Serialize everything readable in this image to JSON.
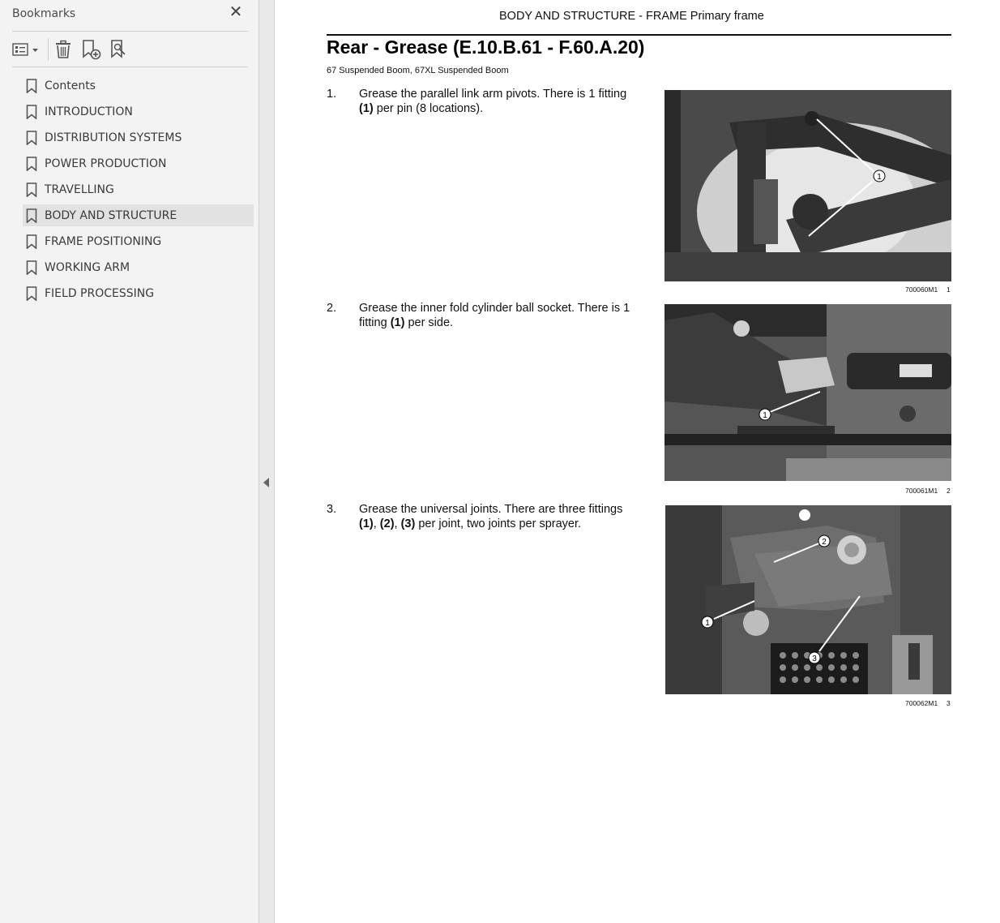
{
  "sidebar": {
    "title": "Bookmarks",
    "close_icon": "close-icon",
    "toolbar": {
      "options_icon": "bookmark-options-icon",
      "delete_icon": "trash-icon",
      "add_icon": "new-bookmark-icon",
      "find_icon": "find-current-bookmark-icon"
    },
    "items": [
      {
        "label": "Contents"
      },
      {
        "label": "INTRODUCTION"
      },
      {
        "label": "DISTRIBUTION SYSTEMS"
      },
      {
        "label": "POWER PRODUCTION"
      },
      {
        "label": "TRAVELLING"
      },
      {
        "label": "BODY AND STRUCTURE",
        "selected": true
      },
      {
        "label": "FRAME POSITIONING"
      },
      {
        "label": "WORKING ARM"
      },
      {
        "label": "FIELD PROCESSING"
      }
    ]
  },
  "document": {
    "header": "BODY AND STRUCTURE - FRAME Primary frame",
    "title": "Rear - Grease (E.10.B.61 - F.60.A.20)",
    "models": "67 Suspended Boom, 67XL Suspended Boom",
    "steps": [
      {
        "number": "1.",
        "text_a": "Grease the parallel link arm pivots. There is 1 fitting",
        "bold_1": "(1)",
        "text_b": " per pin (8 locations).",
        "figure_code": "700060M1",
        "figure_number": "1",
        "callouts": [
          "1"
        ]
      },
      {
        "number": "2.",
        "text_a": "Grease the inner fold cylinder ball socket. There is 1 fitting ",
        "bold_1": "(1)",
        "text_b": " per side.",
        "figure_code": "700061M1",
        "figure_number": "2",
        "callouts": [
          "1"
        ]
      },
      {
        "number": "3.",
        "text_a": "Grease the universal joints. There are three fittings",
        "bold_1": "(1)",
        "sep_1": ", ",
        "bold_2": "(2)",
        "sep_2": ", ",
        "bold_3": "(3)",
        "text_b": " per joint, two joints per sprayer.",
        "figure_code": "700062M1",
        "figure_number": "3",
        "callouts": [
          "1",
          "2",
          "3"
        ]
      }
    ]
  }
}
